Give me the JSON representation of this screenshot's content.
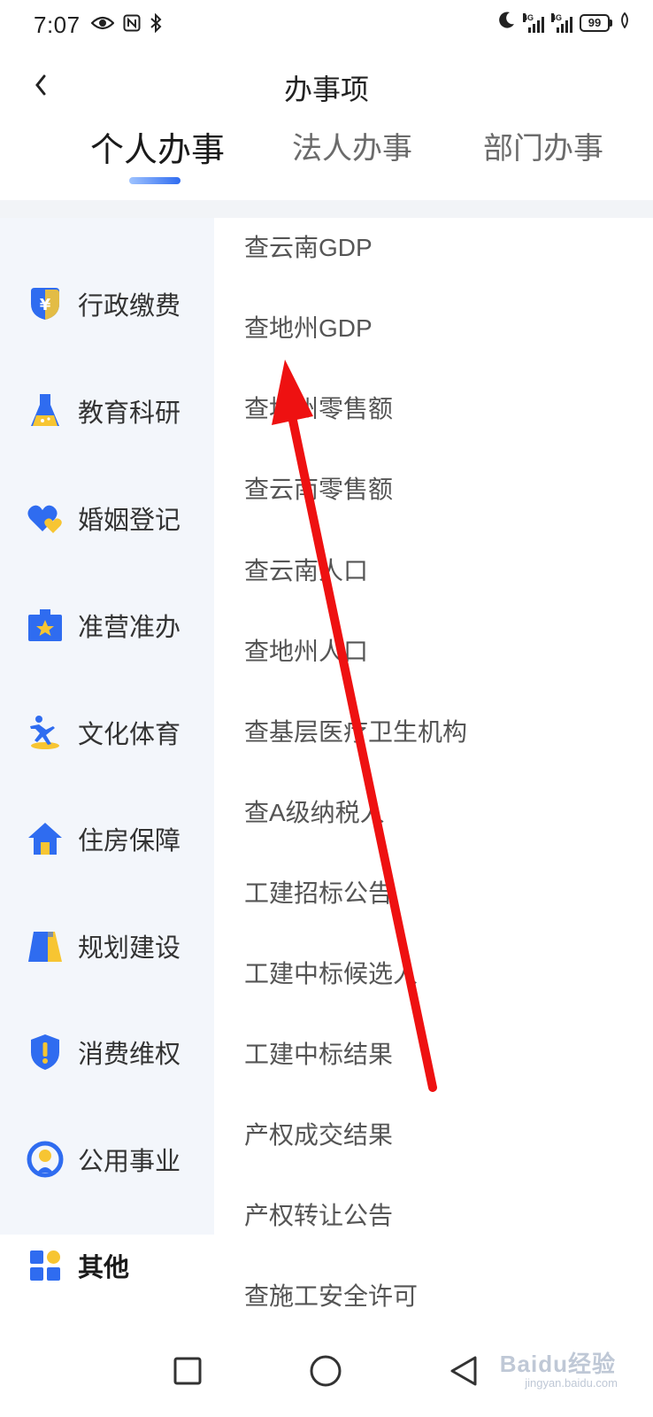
{
  "status_bar": {
    "time": "7:07",
    "network_1": "4G",
    "network_2": "4G",
    "battery": "99"
  },
  "header": {
    "title": "办事项"
  },
  "tabs": [
    {
      "label": "个人办事",
      "active": true
    },
    {
      "label": "法人办事",
      "active": false
    },
    {
      "label": "部门办事",
      "active": false
    }
  ],
  "sidebar": {
    "items": [
      {
        "label": "行政缴费",
        "icon": "yuan-shield-icon"
      },
      {
        "label": "教育科研",
        "icon": "flask-icon"
      },
      {
        "label": "婚姻登记",
        "icon": "hearts-icon"
      },
      {
        "label": "准营准办",
        "icon": "briefcase-star-icon"
      },
      {
        "label": "文化体育",
        "icon": "athlete-icon"
      },
      {
        "label": "住房保障",
        "icon": "house-icon"
      },
      {
        "label": "规划建设",
        "icon": "building-icon"
      },
      {
        "label": "消费维权",
        "icon": "shield-alert-icon"
      },
      {
        "label": "公用事业",
        "icon": "public-utility-icon"
      },
      {
        "label": "其他",
        "icon": "grid-icon",
        "active": true
      }
    ]
  },
  "list": {
    "items": [
      "查云南GDP",
      "查地州GDP",
      "查地州零售额",
      "查云南零售额",
      "查云南人口",
      "查地州人口",
      "查基层医疗卫生机构",
      "查A级纳税人",
      "工建招标公告",
      "工建中标候选人",
      "工建中标结果",
      "产权成交结果",
      "产权转让公告",
      "查施工安全许可"
    ]
  },
  "watermark": {
    "text": "Baidu经验",
    "sub": "jingyan.baidu.com"
  },
  "colors": {
    "accent": "#2f6cf0",
    "sidebar_bg": "#f3f6fb",
    "icon_blue": "#2f6cf0",
    "icon_yellow": "#f7c532",
    "arrow_red": "#ee1111"
  }
}
